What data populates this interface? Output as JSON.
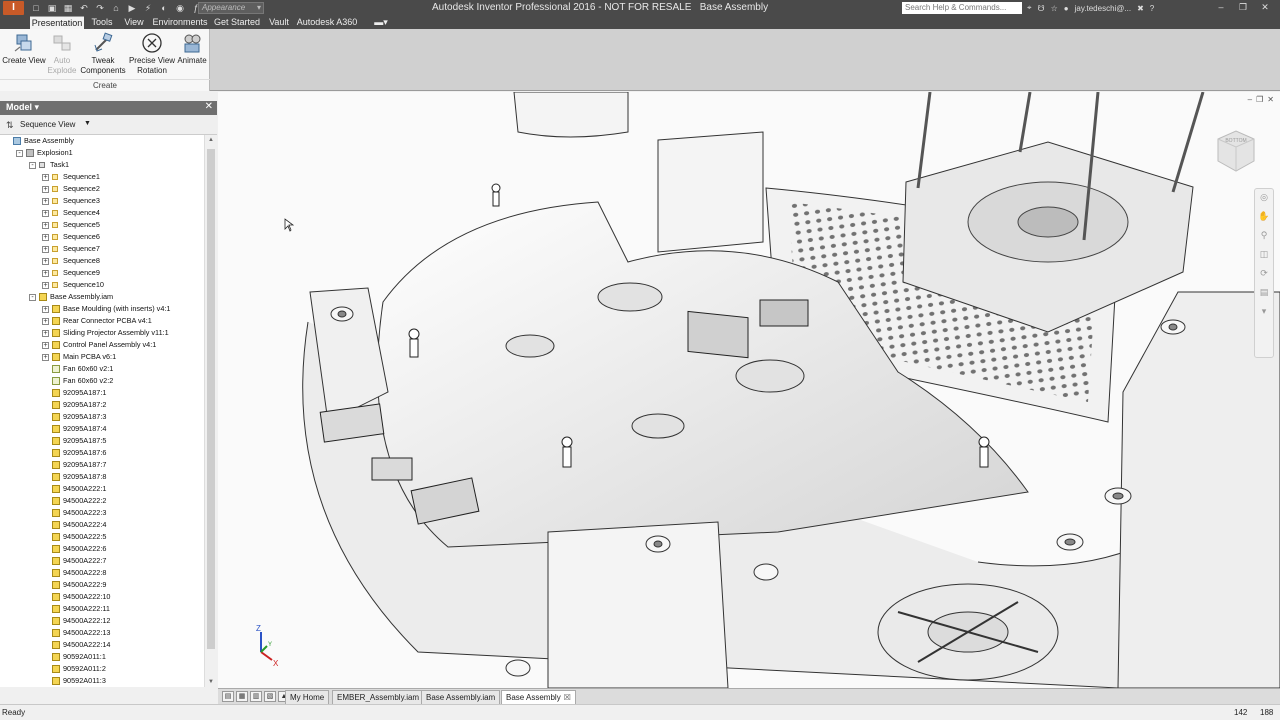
{
  "window": {
    "title": "Autodesk Inventor Professional 2016 - NOT FOR RESALE   Base Assembly",
    "logo_text": "I",
    "appearance_placeholder": "Appearance",
    "search_placeholder": "Search Help & Commands...",
    "user": "jay.tedeschi@..."
  },
  "ribbon": {
    "tabs": [
      "Presentation",
      "Tools",
      "View",
      "Environments",
      "Get Started",
      "Vault",
      "Autodesk A360"
    ],
    "active_tab": "Presentation",
    "buttons": [
      {
        "line1": "Create View",
        "line2": "",
        "enabled": true
      },
      {
        "line1": "Auto",
        "line2": "Explode",
        "enabled": false
      },
      {
        "line1": "Tweak",
        "line2": "Components",
        "enabled": true
      },
      {
        "line1": "Precise View",
        "line2": "Rotation",
        "enabled": true
      },
      {
        "line1": "Animate",
        "line2": "",
        "enabled": true
      }
    ],
    "panel_label": "Create"
  },
  "browser": {
    "title": "Model ▾",
    "view_mode": "Sequence View",
    "tree": [
      {
        "label": "Base Assembly",
        "level": 0,
        "icon": "root",
        "toggle": ""
      },
      {
        "label": "Explosion1",
        "level": 1,
        "icon": "expl",
        "toggle": "-"
      },
      {
        "label": "Task1",
        "level": 2,
        "icon": "task",
        "toggle": "-"
      },
      {
        "label": "Sequence1",
        "level": 3,
        "icon": "seq",
        "toggle": "+"
      },
      {
        "label": "Sequence2",
        "level": 3,
        "icon": "seq",
        "toggle": "+"
      },
      {
        "label": "Sequence3",
        "level": 3,
        "icon": "seq",
        "toggle": "+"
      },
      {
        "label": "Sequence4",
        "level": 3,
        "icon": "seq",
        "toggle": "+"
      },
      {
        "label": "Sequence5",
        "level": 3,
        "icon": "seq",
        "toggle": "+"
      },
      {
        "label": "Sequence6",
        "level": 3,
        "icon": "seq",
        "toggle": "+"
      },
      {
        "label": "Sequence7",
        "level": 3,
        "icon": "seq",
        "toggle": "+"
      },
      {
        "label": "Sequence8",
        "level": 3,
        "icon": "seq",
        "toggle": "+"
      },
      {
        "label": "Sequence9",
        "level": 3,
        "icon": "seq",
        "toggle": "+"
      },
      {
        "label": "Sequence10",
        "level": 3,
        "icon": "seq",
        "toggle": "+"
      },
      {
        "label": "Base Assembly.iam",
        "level": 2,
        "icon": "asm",
        "toggle": "-"
      },
      {
        "label": "Base Moulding (with inserts) v4:1",
        "level": 3,
        "icon": "asm",
        "toggle": "+"
      },
      {
        "label": "Rear Connector PCBA v4:1",
        "level": 3,
        "icon": "asm",
        "toggle": "+"
      },
      {
        "label": "Sliding Projector Assembly v11:1",
        "level": 3,
        "icon": "asm",
        "toggle": "+"
      },
      {
        "label": "Control Panel Assembly v4:1",
        "level": 3,
        "icon": "asm",
        "toggle": "+"
      },
      {
        "label": "Main PCBA v6:1",
        "level": 3,
        "icon": "asm",
        "toggle": "+"
      },
      {
        "label": "Fan 60x60 v2:1",
        "level": 3,
        "icon": "fan",
        "toggle": ""
      },
      {
        "label": "Fan 60x60 v2:2",
        "level": 3,
        "icon": "fan",
        "toggle": ""
      },
      {
        "label": "92095A187:1",
        "level": 3,
        "icon": "part",
        "toggle": ""
      },
      {
        "label": "92095A187:2",
        "level": 3,
        "icon": "part",
        "toggle": ""
      },
      {
        "label": "92095A187:3",
        "level": 3,
        "icon": "part",
        "toggle": ""
      },
      {
        "label": "92095A187:4",
        "level": 3,
        "icon": "part",
        "toggle": ""
      },
      {
        "label": "92095A187:5",
        "level": 3,
        "icon": "part",
        "toggle": ""
      },
      {
        "label": "92095A187:6",
        "level": 3,
        "icon": "part",
        "toggle": ""
      },
      {
        "label": "92095A187:7",
        "level": 3,
        "icon": "part",
        "toggle": ""
      },
      {
        "label": "92095A187:8",
        "level": 3,
        "icon": "part",
        "toggle": ""
      },
      {
        "label": "94500A222:1",
        "level": 3,
        "icon": "part",
        "toggle": ""
      },
      {
        "label": "94500A222:2",
        "level": 3,
        "icon": "part",
        "toggle": ""
      },
      {
        "label": "94500A222:3",
        "level": 3,
        "icon": "part",
        "toggle": ""
      },
      {
        "label": "94500A222:4",
        "level": 3,
        "icon": "part",
        "toggle": ""
      },
      {
        "label": "94500A222:5",
        "level": 3,
        "icon": "part",
        "toggle": ""
      },
      {
        "label": "94500A222:6",
        "level": 3,
        "icon": "part",
        "toggle": ""
      },
      {
        "label": "94500A222:7",
        "level": 3,
        "icon": "part",
        "toggle": ""
      },
      {
        "label": "94500A222:8",
        "level": 3,
        "icon": "part",
        "toggle": ""
      },
      {
        "label": "94500A222:9",
        "level": 3,
        "icon": "part",
        "toggle": ""
      },
      {
        "label": "94500A222:10",
        "level": 3,
        "icon": "part",
        "toggle": ""
      },
      {
        "label": "94500A222:11",
        "level": 3,
        "icon": "part",
        "toggle": ""
      },
      {
        "label": "94500A222:12",
        "level": 3,
        "icon": "part",
        "toggle": ""
      },
      {
        "label": "94500A222:13",
        "level": 3,
        "icon": "part",
        "toggle": ""
      },
      {
        "label": "94500A222:14",
        "level": 3,
        "icon": "part",
        "toggle": ""
      },
      {
        "label": "90592A011:1",
        "level": 3,
        "icon": "part",
        "toggle": ""
      },
      {
        "label": "90592A011:2",
        "level": 3,
        "icon": "part",
        "toggle": ""
      },
      {
        "label": "90592A011:3",
        "level": 3,
        "icon": "part",
        "toggle": ""
      }
    ]
  },
  "viewport": {
    "triad_axes": [
      "Z",
      "X",
      "Y"
    ],
    "viewcube_label": "BOTTOM"
  },
  "doc_tabs": {
    "tabs": [
      "My Home",
      "EMBER_Assembly.iam",
      "Base Assembly.iam",
      "Base Assembly"
    ],
    "active": "Base Assembly",
    "close_glyph": "☒"
  },
  "status": {
    "text": "Ready",
    "num1": "142",
    "num2": "188"
  },
  "colors": {
    "titlebar": "#4a4a4a",
    "logo": "#c85a28",
    "browser_header": "#6f6f6f",
    "part_icon": "#f4d553"
  }
}
